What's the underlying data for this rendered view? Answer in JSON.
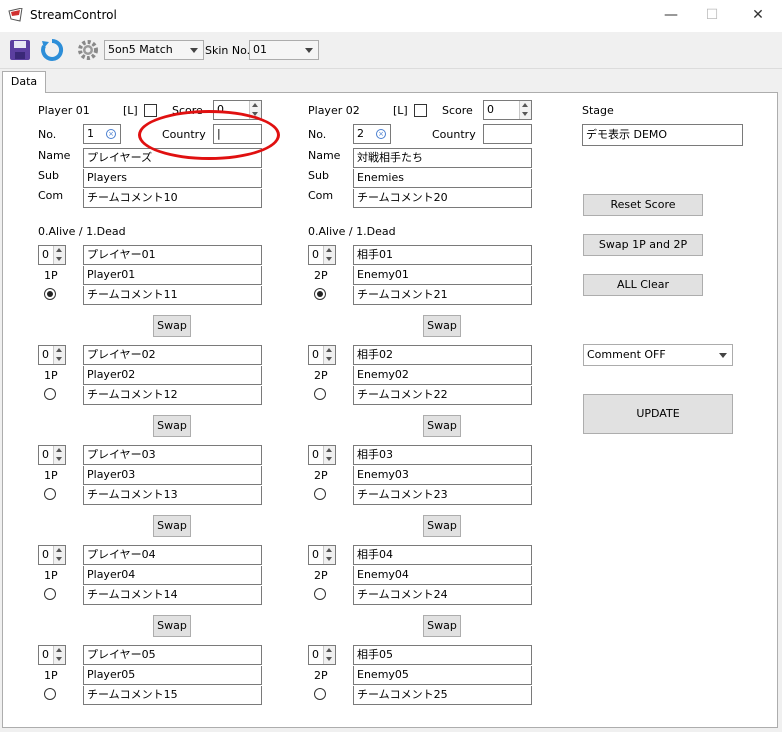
{
  "window": {
    "title": "StreamControl",
    "min": "—",
    "max": "☐",
    "close": "✕"
  },
  "toolbar": {
    "match_select": "5on5 Match",
    "skin_label": "Skin No.",
    "skin_select": "01"
  },
  "tabs": [
    "Data"
  ],
  "p1": {
    "header": "Player 01",
    "lflag": "[L]",
    "score_label": "Score",
    "score": "0",
    "no_label": "No.",
    "no": "1",
    "country_label": "Country",
    "country": "|",
    "name_label": "Name",
    "name": "プレイヤーズ",
    "sub_label": "Sub",
    "sub": "Players",
    "com_label": "Com",
    "com": "チームコメント10",
    "alive_label": "0.Alive / 1.Dead",
    "side": "1P",
    "players": [
      {
        "state": "0",
        "name": "プレイヤー01",
        "sub": "Player01",
        "com": "チームコメント11"
      },
      {
        "state": "0",
        "name": "プレイヤー02",
        "sub": "Player02",
        "com": "チームコメント12"
      },
      {
        "state": "0",
        "name": "プレイヤー03",
        "sub": "Player03",
        "com": "チームコメント13"
      },
      {
        "state": "0",
        "name": "プレイヤー04",
        "sub": "Player04",
        "com": "チームコメント14"
      },
      {
        "state": "0",
        "name": "プレイヤー05",
        "sub": "Player05",
        "com": "チームコメント15"
      }
    ]
  },
  "p2": {
    "header": "Player 02",
    "lflag": "[L]",
    "score_label": "Score",
    "score": "0",
    "no_label": "No.",
    "no": "2",
    "country_label": "Country",
    "country": "",
    "name_label": "Name",
    "name": "対戦相手たち",
    "sub_label": "Sub",
    "sub": "Enemies",
    "com_label": "Com",
    "com": "チームコメント20",
    "alive_label": "0.Alive / 1.Dead",
    "side": "2P",
    "players": [
      {
        "state": "0",
        "name": "相手01",
        "sub": "Enemy01",
        "com": "チームコメント21"
      },
      {
        "state": "0",
        "name": "相手02",
        "sub": "Enemy02",
        "com": "チームコメント22"
      },
      {
        "state": "0",
        "name": "相手03",
        "sub": "Enemy03",
        "com": "チームコメント23"
      },
      {
        "state": "0",
        "name": "相手04",
        "sub": "Enemy04",
        "com": "チームコメント24"
      },
      {
        "state": "0",
        "name": "相手05",
        "sub": "Enemy05",
        "com": "チームコメント25"
      }
    ]
  },
  "swap_label": "Swap",
  "stage": {
    "label": "Stage",
    "value": "デモ表示  DEMO"
  },
  "actions": {
    "reset": "Reset Score",
    "swap": "Swap 1P and 2P",
    "clear": "ALL Clear",
    "comment": "Comment OFF",
    "update": "UPDATE"
  },
  "selected_radio": {
    "p1": 0,
    "p2": 0
  }
}
